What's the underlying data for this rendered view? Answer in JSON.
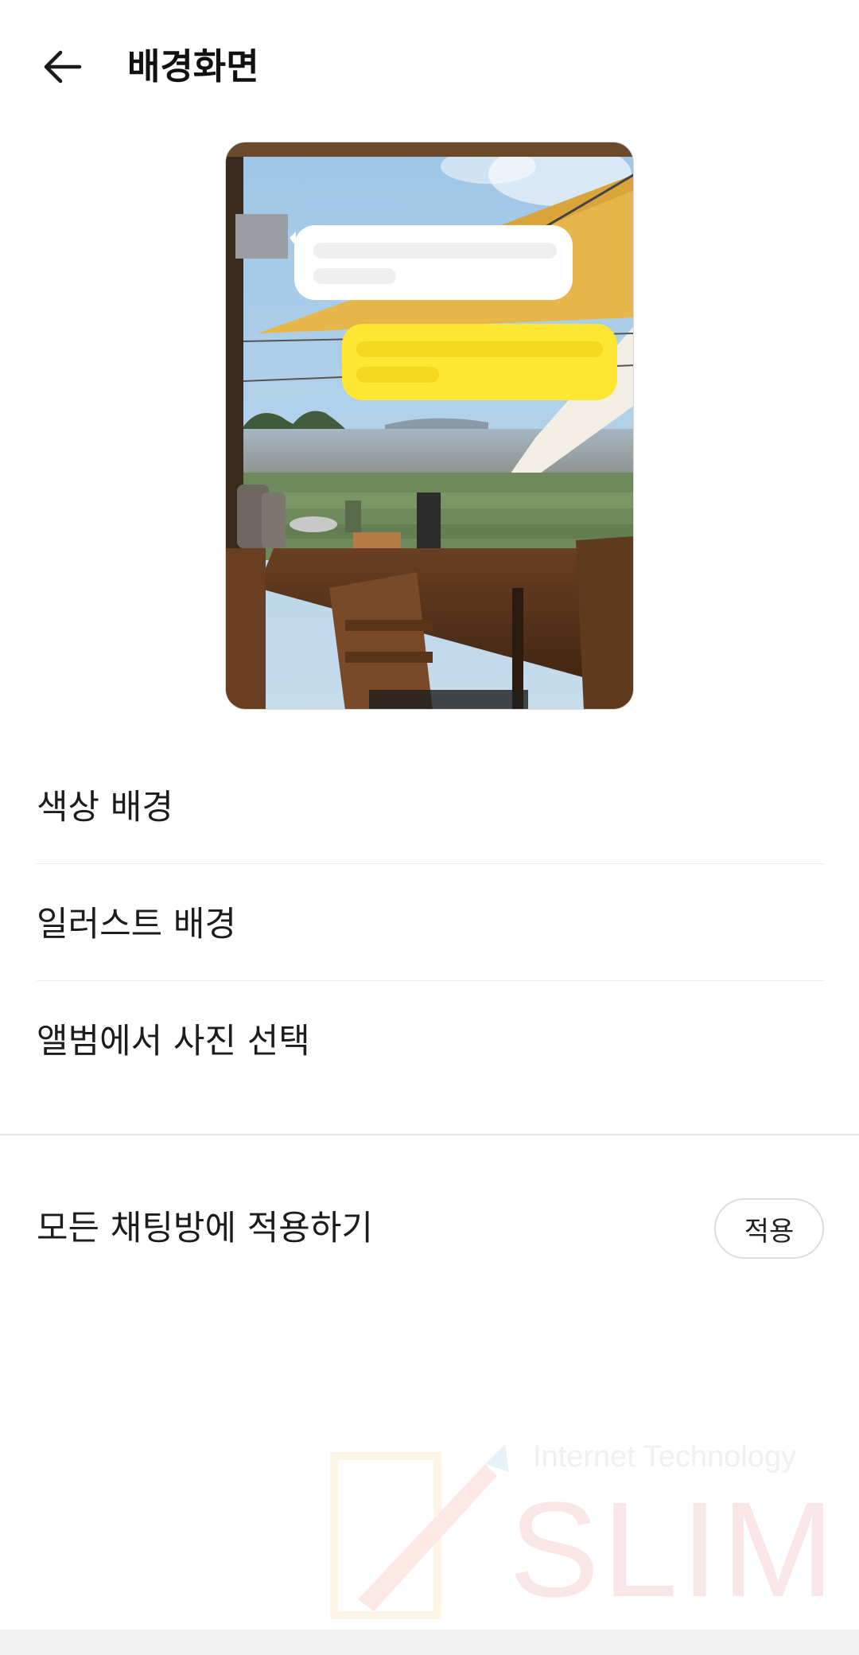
{
  "header": {
    "title": "배경화면",
    "back_icon": "arrow-left-icon"
  },
  "preview": {
    "incoming_bubble_color": "#ffffff",
    "outgoing_bubble_color": "#fee634",
    "avatar_color": "#9a9ea3"
  },
  "menu": {
    "items": [
      {
        "label": "색상 배경"
      },
      {
        "label": "일러스트 배경"
      },
      {
        "label": "앨범에서 사진 선택"
      }
    ]
  },
  "apply_all": {
    "label": "모든 채팅방에 적용하기",
    "button_label": "적용"
  },
  "watermark": {
    "tagline": "Internet Technology",
    "word": "SLIM"
  }
}
